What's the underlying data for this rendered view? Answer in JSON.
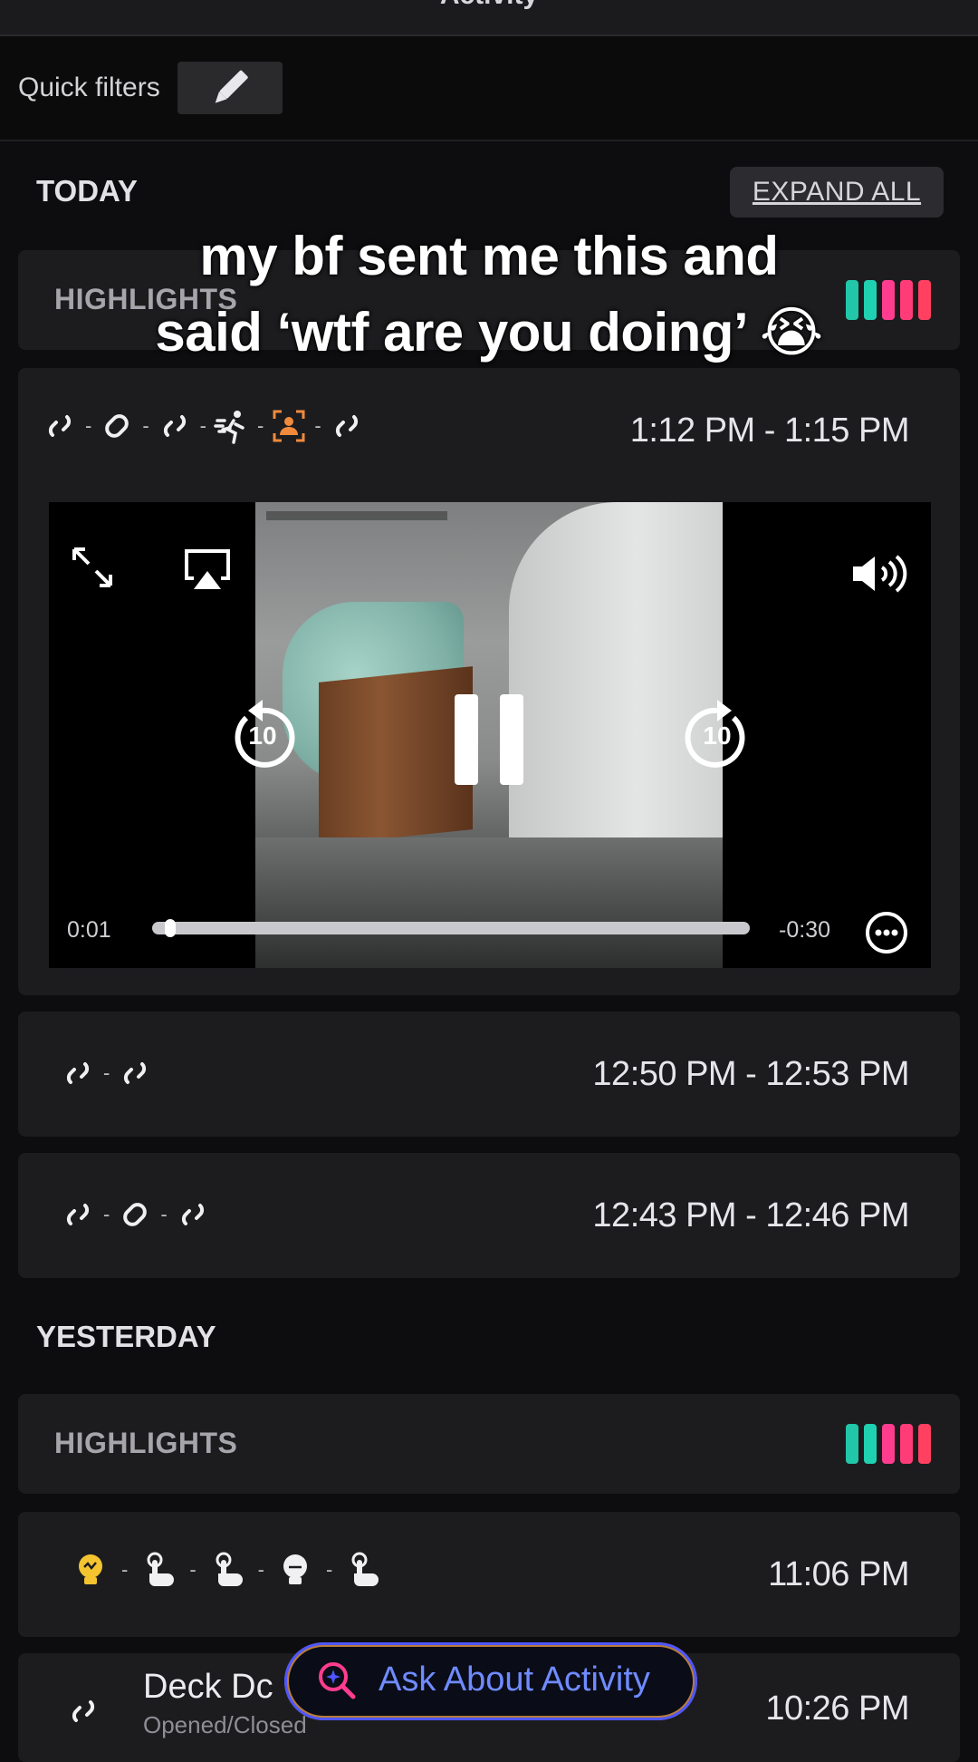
{
  "header": {
    "title": "Activity"
  },
  "quick_filters": {
    "label": "Quick filters"
  },
  "today": {
    "title": "TODAY",
    "expand_all": "EXPAND ALL",
    "highlights_label": "HIGHLIGHTS",
    "highlight_colors": [
      "#21c7a8",
      "#1fd1b0",
      "#ff3c8e",
      "#ff3c78",
      "#ff4060"
    ],
    "caption_line1": "my bf sent me this and",
    "caption_line2": "said ‘wtf are you doing’ 😭",
    "events": [
      {
        "time": "1:12 PM - 1:15 PM",
        "icons": [
          "link-icon",
          "sensor-icon",
          "link-icon",
          "motion-icon",
          "person-icon",
          "link-icon"
        ]
      },
      {
        "time": "12:50 PM - 12:53 PM",
        "icons": [
          "link-icon",
          "link-icon"
        ]
      },
      {
        "time": "12:43 PM - 12:46 PM",
        "icons": [
          "link-icon",
          "sensor-icon",
          "link-icon"
        ]
      }
    ],
    "video": {
      "elapsed": "0:01",
      "remaining": "-0:30",
      "skip_back": "10",
      "skip_forward": "10",
      "progress": 0.03
    }
  },
  "yesterday": {
    "title": "YESTERDAY",
    "highlights_label": "HIGHLIGHTS",
    "events": [
      {
        "time": "11:06 PM",
        "icons": [
          "bulb-icon",
          "touch-icon",
          "touch-icon",
          "bulb-icon",
          "touch-icon"
        ]
      },
      {
        "time": "10:26 PM",
        "title": "Deck Dc",
        "subtitle": "Opened/Closed"
      }
    ]
  },
  "ask_button": {
    "label": "Ask About Activity"
  }
}
